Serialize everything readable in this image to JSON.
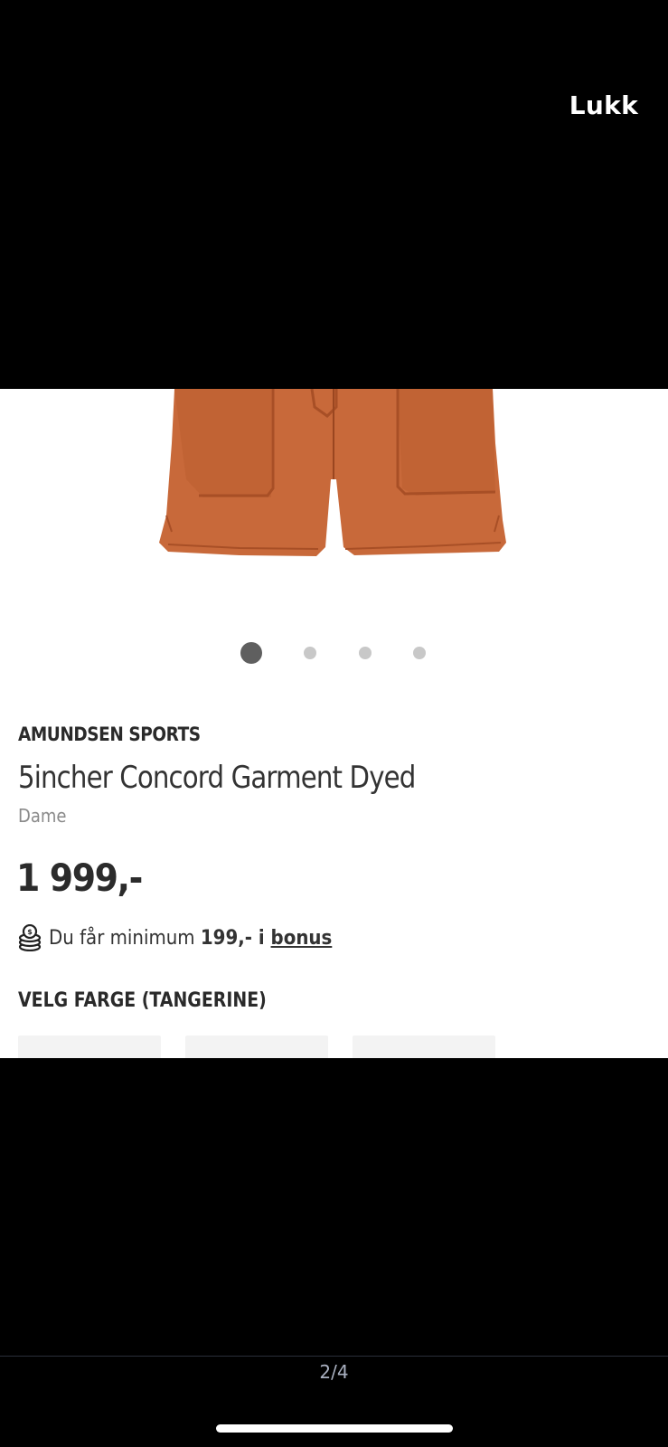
{
  "viewer": {
    "close_label": "Lukk",
    "page_counter": "2/4"
  },
  "product": {
    "brand": "AMUNDSEN SPORTS",
    "name": "5incher Concord Garment Dyed",
    "gender": "Dame",
    "price": "1 999,-",
    "bonus": {
      "prefix": "Du får minimum ",
      "amount": "199,-",
      "middle": " i ",
      "link": "bonus"
    },
    "color_heading": "VELG FARGE (TANGERINE)",
    "image_color": "#c8693a"
  },
  "carousel": {
    "count": 4,
    "active_index": 0
  },
  "icons": {
    "close": "text-button",
    "bonus": "coins-icon"
  }
}
